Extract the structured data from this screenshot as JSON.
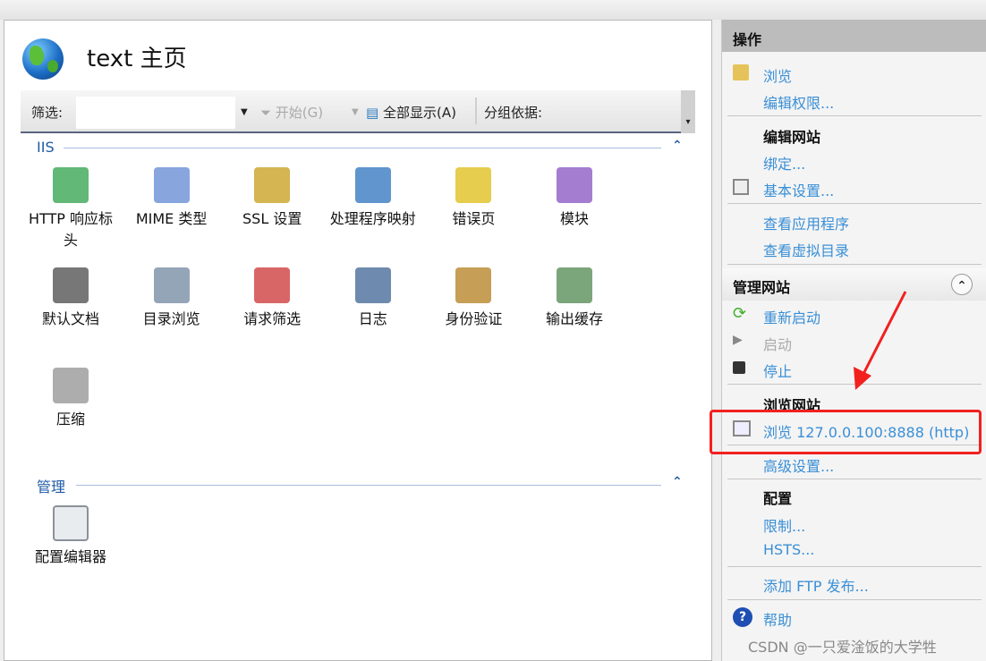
{
  "page": {
    "title": "text 主页"
  },
  "toolbar": {
    "filter_label": "筛选:",
    "filter_value": "",
    "go": "开始(G)",
    "show_all": "全部显示(A)",
    "group_by": "分组依据:"
  },
  "sections": {
    "iis": "IIS",
    "manage": "管理"
  },
  "features": [
    {
      "label": "HTTP 响应标头",
      "icon": "http-response-headers-icon"
    },
    {
      "label": "MIME 类型",
      "icon": "mime-types-icon"
    },
    {
      "label": "SSL 设置",
      "icon": "ssl-lock-icon"
    },
    {
      "label": "处理程序映射",
      "icon": "handler-mappings-icon"
    },
    {
      "label": "错误页",
      "icon": "error-pages-icon"
    },
    {
      "label": "模块",
      "icon": "modules-icon"
    },
    {
      "label": "默认文档",
      "icon": "default-document-icon"
    },
    {
      "label": "目录浏览",
      "icon": "directory-browsing-icon"
    },
    {
      "label": "请求筛选",
      "icon": "request-filtering-icon"
    },
    {
      "label": "日志",
      "icon": "logging-icon"
    },
    {
      "label": "身份验证",
      "icon": "authentication-icon"
    },
    {
      "label": "输出缓存",
      "icon": "output-caching-icon"
    },
    {
      "label": "压缩",
      "icon": "compression-icon"
    }
  ],
  "manage_features": [
    {
      "label": "配置编辑器",
      "icon": "configuration-editor-icon"
    }
  ],
  "actions": {
    "header": "操作",
    "explore": "浏览",
    "edit_permissions": "编辑权限...",
    "edit_site": "编辑网站",
    "bindings": "绑定...",
    "basic_settings": "基本设置...",
    "view_apps": "查看应用程序",
    "view_vdirs": "查看虚拟目录",
    "manage_site": "管理网站",
    "restart": "重新启动",
    "start": "启动",
    "stop": "停止",
    "browse_site": "浏览网站",
    "browse_link": "浏览 127.0.0.100:8888 (http)",
    "advanced": "高级设置...",
    "config": "配置",
    "limits": "限制...",
    "hsts": "HSTS...",
    "ftp": "添加 FTP 发布...",
    "help": "帮助"
  },
  "watermark": "CSDN @一只爱淦饭的大学牲",
  "colors": {
    "link": "#3a8fd6",
    "annotation": "#f2201f"
  }
}
